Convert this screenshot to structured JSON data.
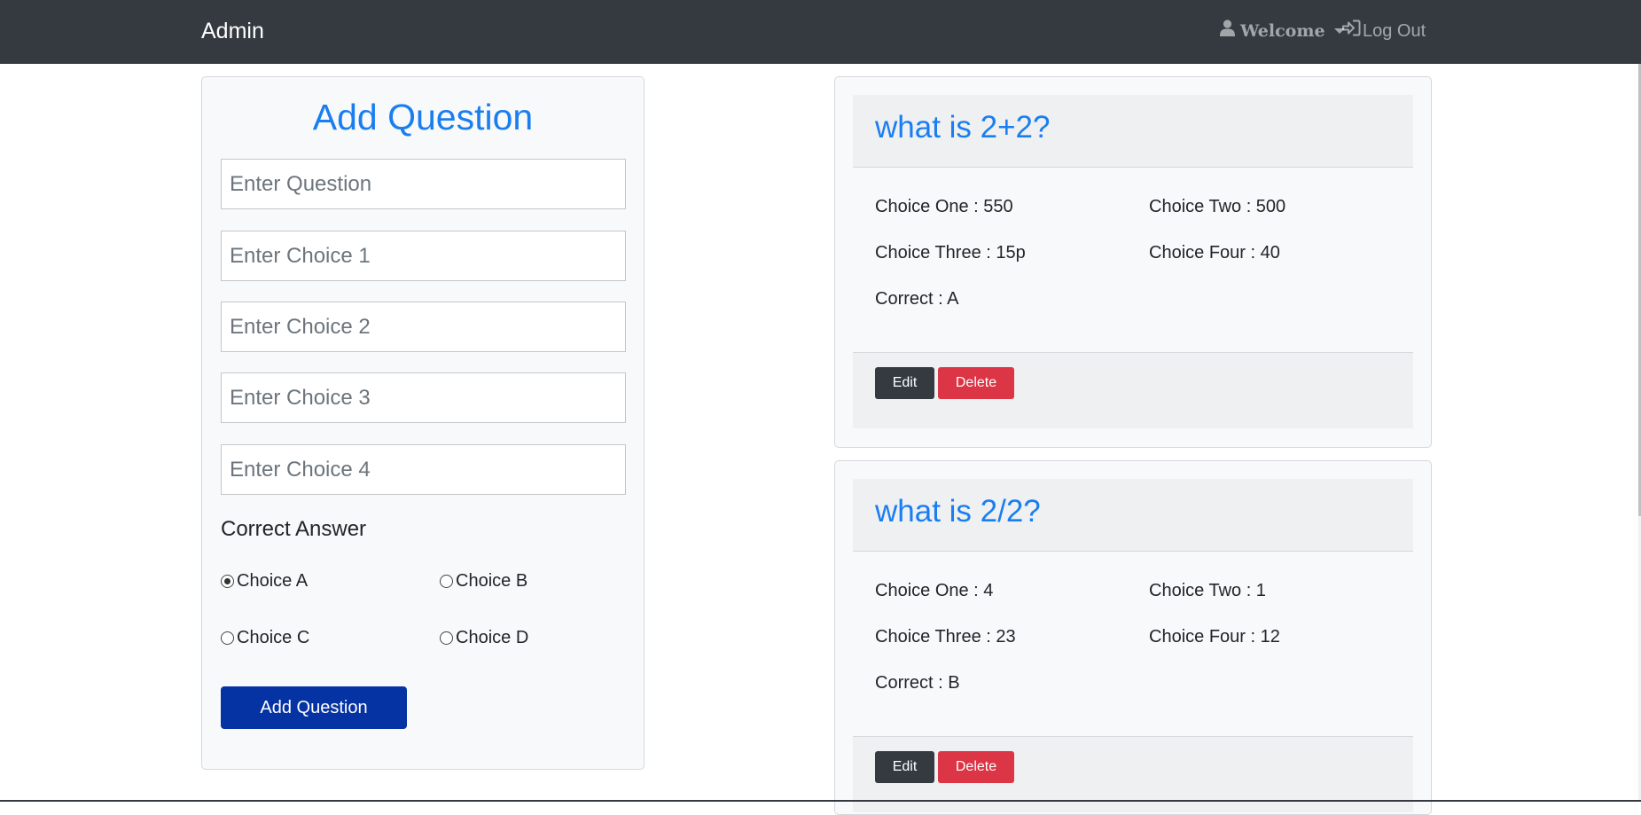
{
  "navbar": {
    "brand": "Admin",
    "welcome_label": "Welcome",
    "logout_label": "Log Out"
  },
  "form": {
    "title": "Add Question",
    "question_placeholder": "Enter Question",
    "choice1_placeholder": "Enter Choice 1",
    "choice2_placeholder": "Enter Choice 2",
    "choice3_placeholder": "Enter Choice 3",
    "choice4_placeholder": "Enter Choice 4",
    "correct_label": "Correct Answer",
    "options": [
      {
        "label": "Choice A",
        "checked": true
      },
      {
        "label": "Choice B",
        "checked": false
      },
      {
        "label": "Choice C",
        "checked": false
      },
      {
        "label": "Choice D",
        "checked": false
      }
    ],
    "submit_label": "Add Question"
  },
  "questions": [
    {
      "title": "what is 2+2?",
      "choice_one": "Choice One : 550",
      "choice_two": "Choice Two : 500",
      "choice_three": "Choice Three : 15p",
      "choice_four": "Choice Four : 40",
      "correct": "Correct : A",
      "edit_label": "Edit",
      "delete_label": "Delete"
    },
    {
      "title": "what is 2/2?",
      "choice_one": "Choice One : 4",
      "choice_two": "Choice Two : 1",
      "choice_three": "Choice Three : 23",
      "choice_four": "Choice Four : 12",
      "correct": "Correct : B",
      "edit_label": "Edit",
      "delete_label": "Delete"
    }
  ],
  "colors": {
    "navbar": "#343a40",
    "accent_blue": "#1a7ef0",
    "primary_button": "#0533a3",
    "danger": "#dc3545",
    "dark_button": "#343a40"
  },
  "icons": {
    "welcome": "user-icon",
    "logout": "sign-in-icon"
  }
}
